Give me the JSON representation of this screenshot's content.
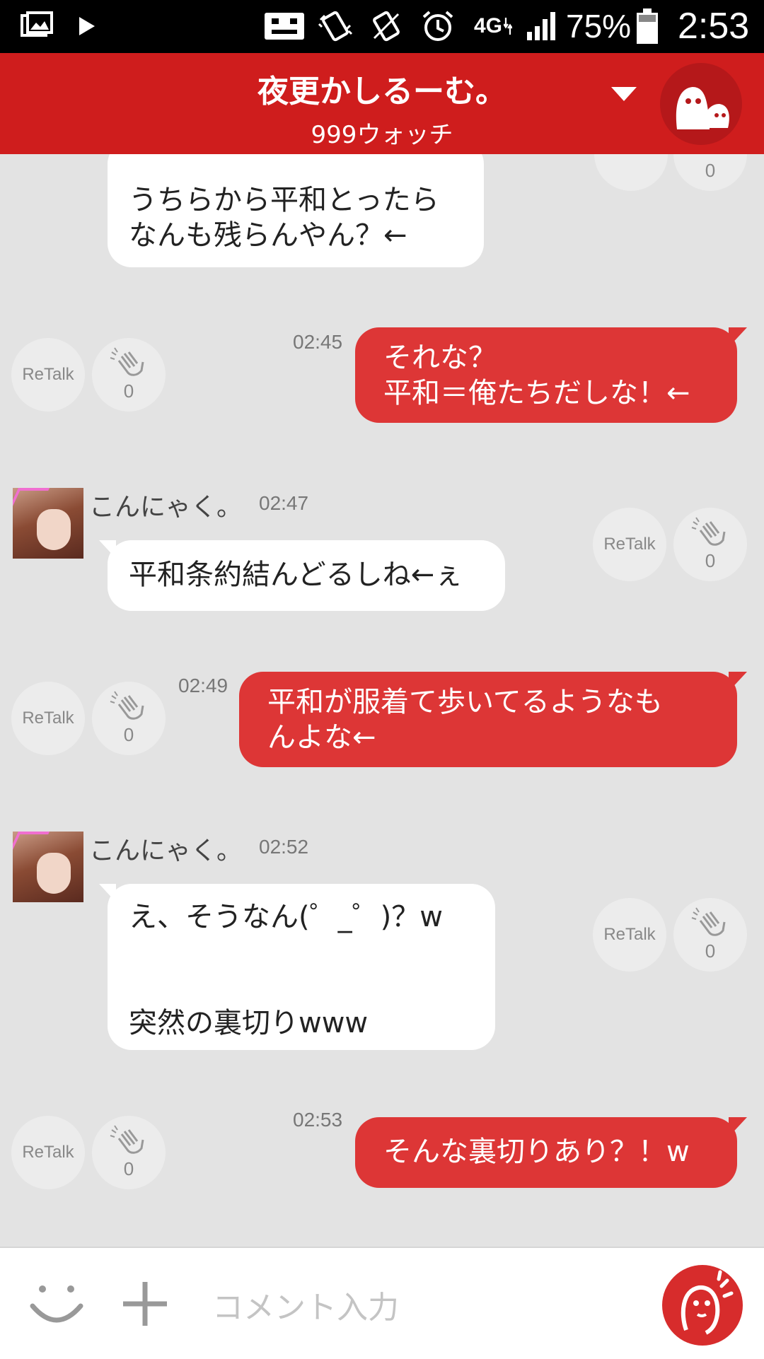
{
  "status_bar": {
    "battery": "75%",
    "clock": "2:53",
    "network": "4G"
  },
  "header": {
    "title": "夜更かしるーむ。",
    "subtitle": "999ウォッチ"
  },
  "messages": [
    {
      "dir": "in",
      "lines": [
        "うちらから平和とったら",
        "なんも残らんやん？←"
      ]
    },
    {
      "dir": "out",
      "time": "02:45",
      "lines": [
        "それな？",
        "平和＝俺たちだしな！←"
      ],
      "retalk": "ReTalk",
      "claps": "0"
    },
    {
      "dir": "in",
      "sender": "こんにゃく。",
      "time": "02:47",
      "lines": [
        "平和条約結んどるしね←ぇ"
      ],
      "retalk": "ReTalk",
      "claps": "0"
    },
    {
      "dir": "out",
      "time": "02:49",
      "lines": [
        "平和が服着て歩いてるようなも",
        "んよな←"
      ],
      "retalk": "ReTalk",
      "claps": "0"
    },
    {
      "dir": "in",
      "sender": "こんにゃく。",
      "time": "02:52",
      "lines": [
        "え、そうなん(゜_゜)？w",
        "",
        "",
        "突然の裏切りwww"
      ],
      "retalk": "ReTalk",
      "claps": "0"
    },
    {
      "dir": "out",
      "time": "02:53",
      "lines": [
        "そんな裏切りあり？！w"
      ],
      "retalk": "ReTalk",
      "claps": "0"
    }
  ],
  "top_partial_claps": "0",
  "input": {
    "placeholder": "コメント入力"
  },
  "colors": {
    "header": "#cf1d1d",
    "outgoing_bubble": "#dd3636",
    "background": "#e3e3e3"
  }
}
